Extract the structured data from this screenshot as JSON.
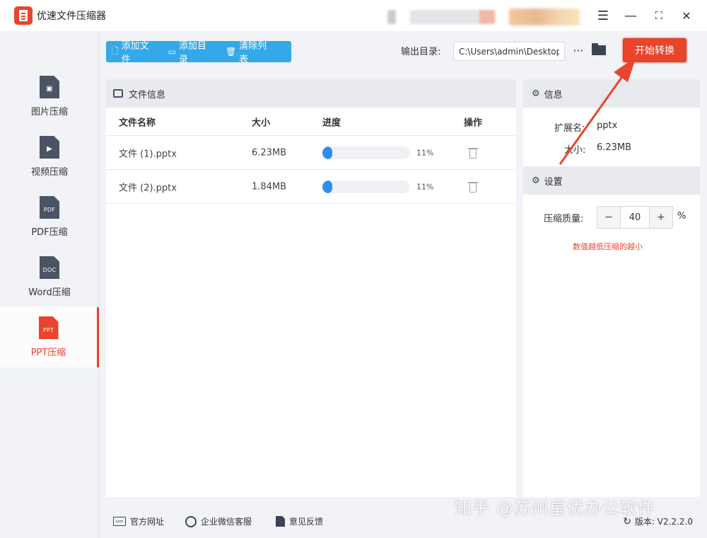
{
  "app": {
    "title": "优速文件压缩器"
  },
  "window_controls": {
    "menu": "☰",
    "minimize": "—",
    "maximize": "⛶",
    "close": "✕"
  },
  "sidebar": {
    "items": [
      {
        "label": "图片压缩",
        "icon": "image-file-icon",
        "tag": "▣",
        "active": false
      },
      {
        "label": "视频压缩",
        "icon": "video-file-icon",
        "tag": "▶",
        "active": false
      },
      {
        "label": "PDF压缩",
        "icon": "pdf-file-icon",
        "tag": "PDF",
        "active": false
      },
      {
        "label": "Word压缩",
        "icon": "word-file-icon",
        "tag": "DOC",
        "active": false
      },
      {
        "label": "PPT压缩",
        "icon": "ppt-file-icon",
        "tag": "PPT",
        "active": true
      }
    ]
  },
  "toolbar": {
    "add_file": "添加文件",
    "add_folder": "添加目录",
    "clear_list": "清除列表",
    "output_label": "输出目录:",
    "output_path": "C:\\Users\\admin\\Desktop",
    "more": "···",
    "start_label": "开始转换"
  },
  "file_panel": {
    "title": "文件信息",
    "columns": {
      "name": "文件名称",
      "size": "大小",
      "progress": "进度",
      "action": "操作"
    },
    "rows": [
      {
        "name": "文件 (1).pptx",
        "size": "6.23MB",
        "progress": 0.11,
        "progress_text": "11%"
      },
      {
        "name": "文件 (2).pptx",
        "size": "1.84MB",
        "progress": 0.11,
        "progress_text": "11%"
      }
    ]
  },
  "info_panel": {
    "title": "信息",
    "ext_label": "扩展名:",
    "ext_value": "pptx",
    "size_label": "大小:",
    "size_value": "6.23MB"
  },
  "settings_panel": {
    "title": "设置",
    "quality_label": "压缩质量:",
    "quality_value": "40",
    "minus": "−",
    "plus": "+",
    "unit": "%",
    "hint": "数值越低压缩的越小"
  },
  "footer": {
    "website": "官方网址",
    "website_icon_text": "com",
    "wechat": "企业微信客服",
    "feedback": "意见反馈",
    "version": "版本: V2.2.2.0"
  },
  "watermark": "知乎 @苏州星优办公软件",
  "colors": {
    "accent": "#e8452c",
    "toolbar_blue": "#34a8e8",
    "progress_blue": "#2f8eea"
  }
}
